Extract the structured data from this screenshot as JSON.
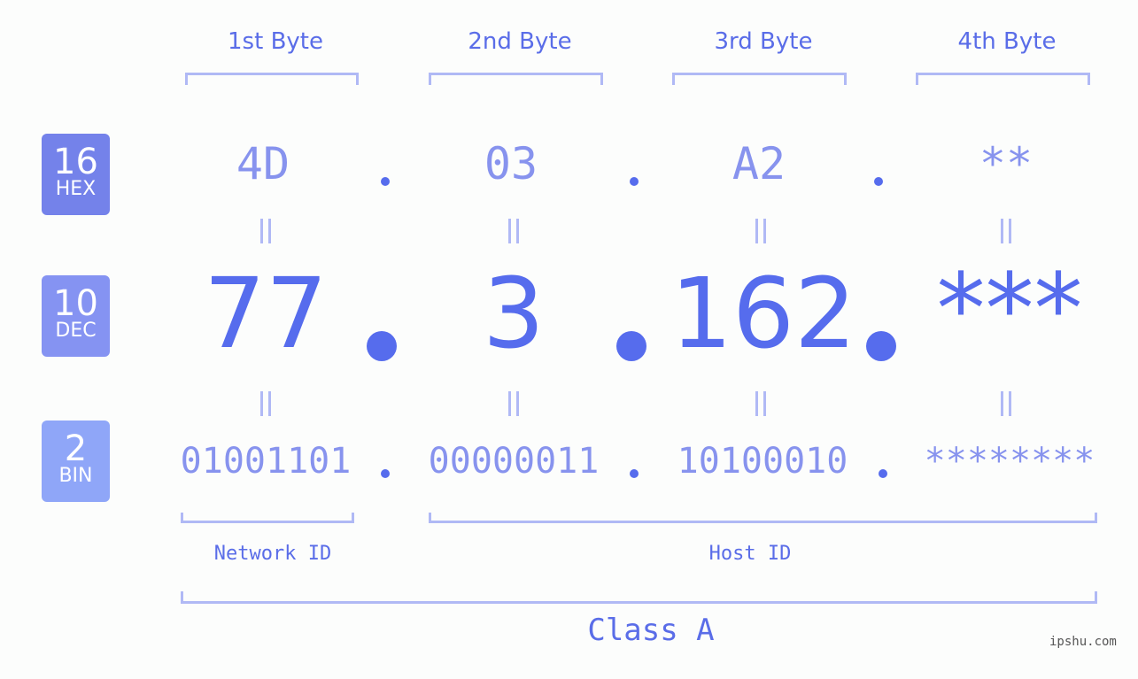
{
  "byte_headers": [
    "1st Byte",
    "2nd Byte",
    "3rd Byte",
    "4th Byte"
  ],
  "bases": [
    {
      "num": "16",
      "label": "HEX",
      "color": "#7482ea"
    },
    {
      "num": "10",
      "label": "DEC",
      "color": "#8593f2"
    },
    {
      "num": "2",
      "label": "BIN",
      "color": "#8fa6f8"
    }
  ],
  "hex": [
    "4D",
    "03",
    "A2",
    "**"
  ],
  "dec": [
    "77",
    "3",
    "162",
    "***"
  ],
  "bin": [
    "01001101",
    "00000011",
    "10100010",
    "********"
  ],
  "network_id_label": "Network ID",
  "host_id_label": "Host ID",
  "class_label": "Class A",
  "watermark": "ipshu.com",
  "colors": {
    "accent": "#566ced",
    "light": "#b0b9f5",
    "mid": "#8793ee"
  }
}
